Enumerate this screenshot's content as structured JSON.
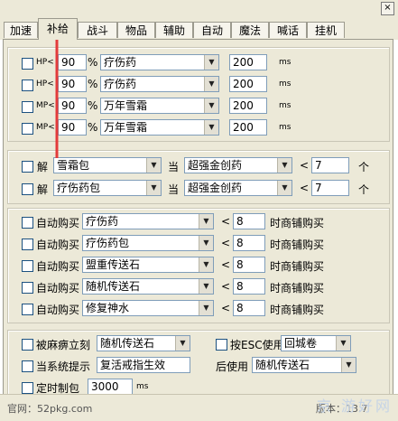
{
  "window": {
    "close_symbol": "×"
  },
  "tabs": [
    "加速",
    "补给",
    "战斗",
    "物品",
    "辅助",
    "自动",
    "魔法",
    "喊话",
    "挂机"
  ],
  "hp_mp": [
    {
      "label": "HP<",
      "pct": "90",
      "unit": "%",
      "item": "疗伤药",
      "delay": "200",
      "delay_unit": "ms"
    },
    {
      "label": "HP<",
      "pct": "90",
      "unit": "%",
      "item": "疗伤药",
      "delay": "200",
      "delay_unit": "ms"
    },
    {
      "label": "MP<",
      "pct": "90",
      "unit": "%",
      "item": "万年雪霜",
      "delay": "200",
      "delay_unit": "ms"
    },
    {
      "label": "MP<",
      "pct": "90",
      "unit": "%",
      "item": "万年雪霜",
      "delay": "200",
      "delay_unit": "ms"
    }
  ],
  "unpack": [
    {
      "label": "解",
      "item": "雪霜包",
      "when": "当",
      "cond": "超强金创药",
      "lt": "<",
      "count": "7",
      "unit": "个"
    },
    {
      "label": "解",
      "item": "疗伤药包",
      "when": "当",
      "cond": "超强金创药",
      "lt": "<",
      "count": "7",
      "unit": "个"
    }
  ],
  "autobuy": [
    {
      "label": "自动购买",
      "item": "疗伤药",
      "lt": "<",
      "count": "8",
      "suffix": "时商铺购买"
    },
    {
      "label": "自动购买",
      "item": "疗伤药包",
      "lt": "<",
      "count": "8",
      "suffix": "时商铺购买"
    },
    {
      "label": "自动购买",
      "item": "盟重传送石",
      "lt": "<",
      "count": "8",
      "suffix": "时商铺购买"
    },
    {
      "label": "自动购买",
      "item": "随机传送石",
      "lt": "<",
      "count": "8",
      "suffix": "时商铺购买"
    },
    {
      "label": "自动购买",
      "item": "修复神水",
      "lt": "<",
      "count": "8",
      "suffix": "时商铺购买"
    }
  ],
  "misc": {
    "paralyze_label": "被麻痹立刻",
    "paralyze_item": "随机传送石",
    "esc_label": "按ESC使用",
    "esc_item": "回城卷",
    "sysmsg_label": "当系统提示",
    "sysmsg_value": "复活戒指生效",
    "after_label": "后使用",
    "after_item": "随机传送石",
    "timed_label": "定时制包",
    "timed_value": "3000",
    "timed_unit": "ms"
  },
  "footer": {
    "website": "官网：52pkg.com",
    "version": "版本：13.7",
    "watermark": "京 游好网"
  },
  "colors": {
    "annotation_arrow": "#e33b3b"
  }
}
